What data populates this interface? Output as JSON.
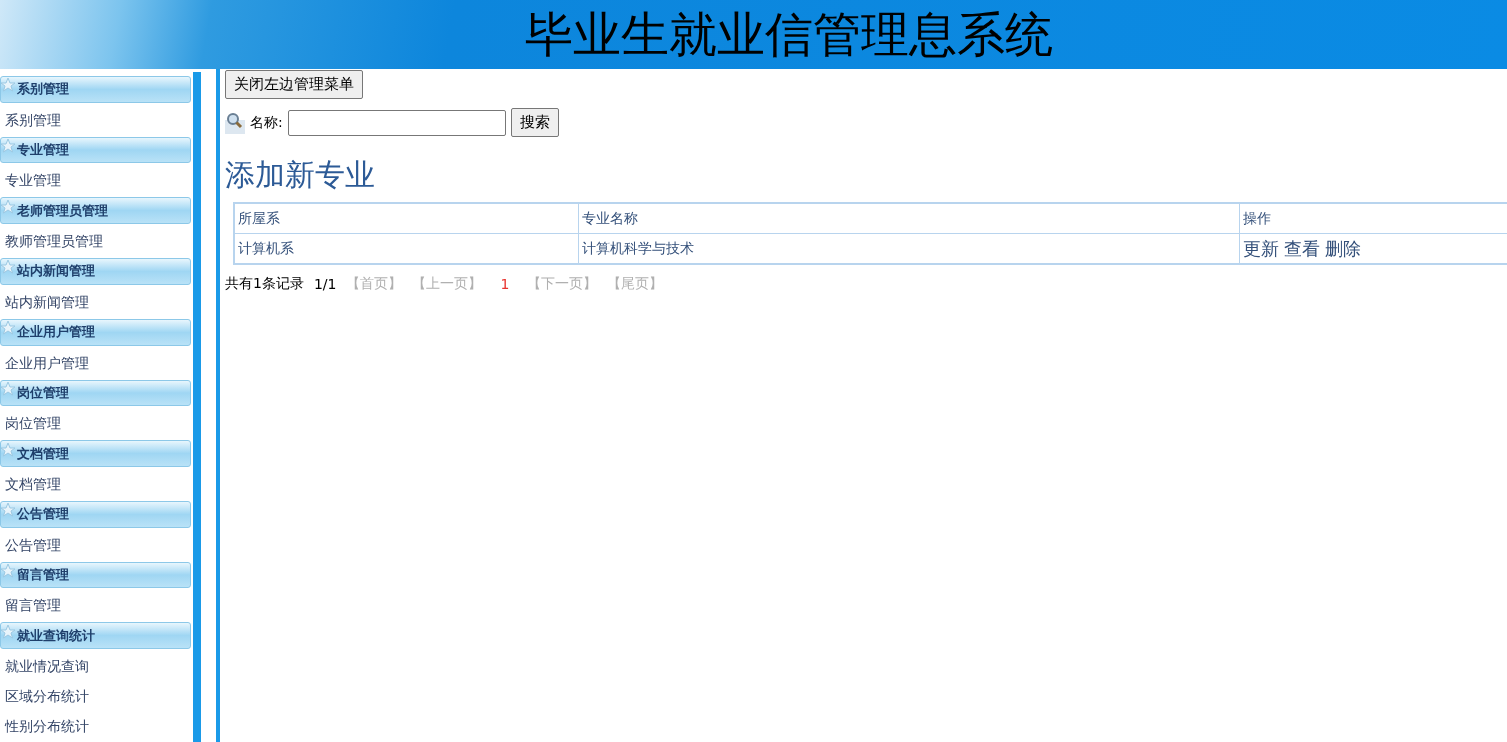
{
  "header": {
    "title": "毕业生就业信管理息系统"
  },
  "sidebar": {
    "groups": [
      {
        "title": "系别管理",
        "items": [
          "系别管理"
        ]
      },
      {
        "title": "专业管理",
        "items": [
          "专业管理"
        ]
      },
      {
        "title": "老师管理员管理",
        "items": [
          "教师管理员管理"
        ]
      },
      {
        "title": "站内新闻管理",
        "items": [
          "站内新闻管理"
        ]
      },
      {
        "title": "企业用户管理",
        "items": [
          "企业用户管理"
        ]
      },
      {
        "title": "岗位管理",
        "items": [
          "岗位管理"
        ]
      },
      {
        "title": "文档管理",
        "items": [
          "文档管理"
        ]
      },
      {
        "title": "公告管理",
        "items": [
          "公告管理"
        ]
      },
      {
        "title": "留言管理",
        "items": [
          "留言管理"
        ]
      },
      {
        "title": "就业查询统计",
        "items": [
          "就业情况查询",
          "区域分布统计",
          "性别分布统计"
        ]
      }
    ]
  },
  "toggle_button": "关闭左边管理菜单",
  "search": {
    "label": "名称:",
    "button": "搜索"
  },
  "heading": "添加新专业",
  "table": {
    "columns": [
      "所屋系",
      "专业名称",
      "操作"
    ],
    "rows": [
      {
        "cells": [
          "计算机系",
          "计算机科学与技术"
        ],
        "actions": [
          "更新",
          "查看",
          "删除"
        ]
      }
    ]
  },
  "pager": {
    "summary": "共有1条记录",
    "page": "1/1",
    "links": [
      {
        "label": "【首页】",
        "disabled": true
      },
      {
        "label": "【上一页】",
        "disabled": true
      },
      {
        "label": "1",
        "kind": "current"
      },
      {
        "label": "【下一页】",
        "disabled": true
      },
      {
        "label": "【尾页】",
        "disabled": true
      }
    ]
  }
}
